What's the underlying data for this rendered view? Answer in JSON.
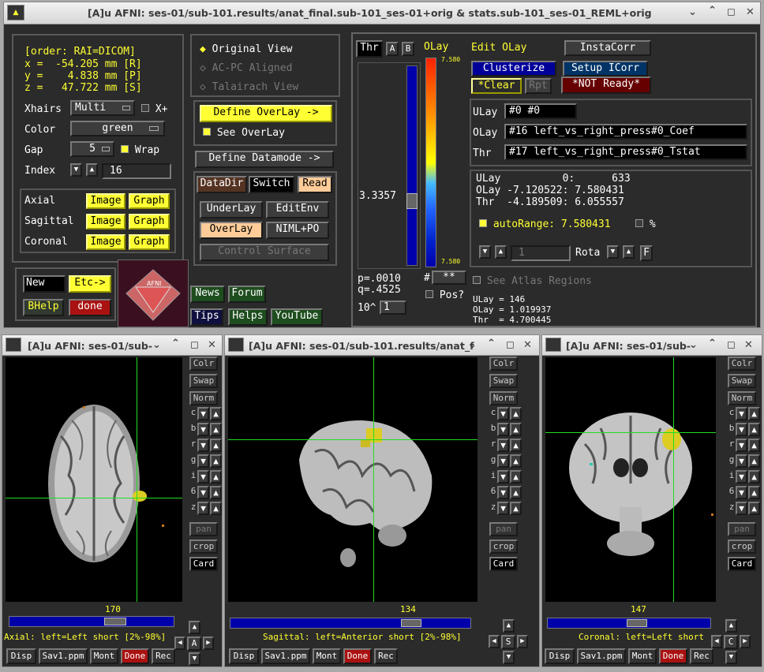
{
  "main": {
    "title": "[A]u AFNI: ses-01/sub-101.results/anat_final.sub-101_ses-01+orig & stats.sub-101_ses-01_REML+orig",
    "coords": {
      "order": "[order: RAI=DICOM]",
      "x": "x =  -54.205 mm [R]",
      "y": "y =    4.838 mm [P]",
      "z": "z =   47.722 mm [S]"
    },
    "xhairs_label": "Xhairs",
    "xhairs_value": "Multi",
    "xplus": "X+",
    "color_label": "Color",
    "color_value": "green",
    "gap_label": "Gap",
    "gap_value": "5",
    "wrap": "Wrap",
    "index_label": "Index",
    "index_value": "16",
    "views": [
      {
        "name": "Axial",
        "image": "Image",
        "graph": "Graph"
      },
      {
        "name": "Sagittal",
        "image": "Image",
        "graph": "Graph"
      },
      {
        "name": "Coronal",
        "image": "Image",
        "graph": "Graph"
      }
    ],
    "new": "New",
    "etc": "Etc->",
    "bhelp": "BHelp",
    "done": "done",
    "orig_view": "Original View",
    "acpc": "AC-PC Aligned",
    "tal": "Talairach View",
    "define_overlay": "Define OverLay ->",
    "see_overlay": "See OverLay",
    "define_datamode": "Define Datamode ->",
    "datadir": "DataDir",
    "switch": "Switch",
    "read": "Read",
    "underlay": "UnderLay",
    "editenv": "EditEnv",
    "overlay": "OverLay",
    "niml": "NIML+PO",
    "control_surface": "Control Surface",
    "news": "News",
    "forum": "Forum",
    "tips": "Tips",
    "helps": "Helps",
    "youtube": "YouTube",
    "thr": "Thr",
    "a": "A",
    "b": "B",
    "olay": "OLay",
    "scale_top": "7.580",
    "scale_bot": "7.580",
    "thr_value": "3.3357",
    "p": "p=.0010",
    "q": "q=.4525",
    "exp": "10^",
    "exp_val": "1",
    "hash": "#",
    "hash_val": "**",
    "pos": "Pos?",
    "edit_olay": "Edit OLay",
    "instacorr": "InstaCorr",
    "clusterize": "Clusterize",
    "setup_icorr": "Setup ICorr",
    "clear": "*Clear",
    "rpt": "Rpt",
    "not_ready": "*NOT Ready*",
    "ulay_lbl": "ULay",
    "ulay_val": "#0 #0",
    "olay_lbl": "OLay",
    "olay_val": "#16 left_vs_right_press#0_Coef",
    "thr_lbl": "Thr",
    "thr_val": "#17 left_vs_right_press#0_Tstat",
    "info1": "ULay          0:      633",
    "info2": "OLay -7.120522: 7.580431",
    "info3": "Thr  -4.189509: 6.055557",
    "autorange": "autoRange: 7.580431",
    "pct": "%",
    "rota_num": "1",
    "rota": "Rota",
    "f": "F",
    "see_atlas": "See Atlas Regions",
    "val1": "ULay = 146",
    "val2": "OLay = 1.019937",
    "val3": "Thr  = 4.700445"
  },
  "viewers": [
    {
      "title": "[A]u AFNI: ses-01/sub-",
      "slice": "170",
      "label": "Axial: left=Left short [2%-98%]",
      "letter": "A"
    },
    {
      "title": "[A]u AFNI: ses-01/sub-101.results/anat_f",
      "slice": "134",
      "label": "Sagittal: left=Anterior short [2%-98%]",
      "letter": "S"
    },
    {
      "title": "[A]u AFNI: ses-01/sub-",
      "slice": "147",
      "label": "Coronal: left=Left short",
      "letter": "C"
    }
  ],
  "side_buttons": {
    "colr": "Colr",
    "swap": "Swap",
    "norm": "Norm",
    "pan": "pan",
    "crop": "crop",
    "card": "Card",
    "letters": [
      "c",
      "b",
      "r",
      "g",
      "i",
      "6",
      "z"
    ]
  },
  "bottom_buttons": {
    "disp": "Disp",
    "sav": "Sav1.ppm",
    "mont": "Mont",
    "done": "Done",
    "rec": "Rec"
  },
  "colors": {
    "overlay_blob": "#ddcc22",
    "crosshair": "#22dd22",
    "panel": "#2b2b2b",
    "yellow": "#ffff33"
  }
}
